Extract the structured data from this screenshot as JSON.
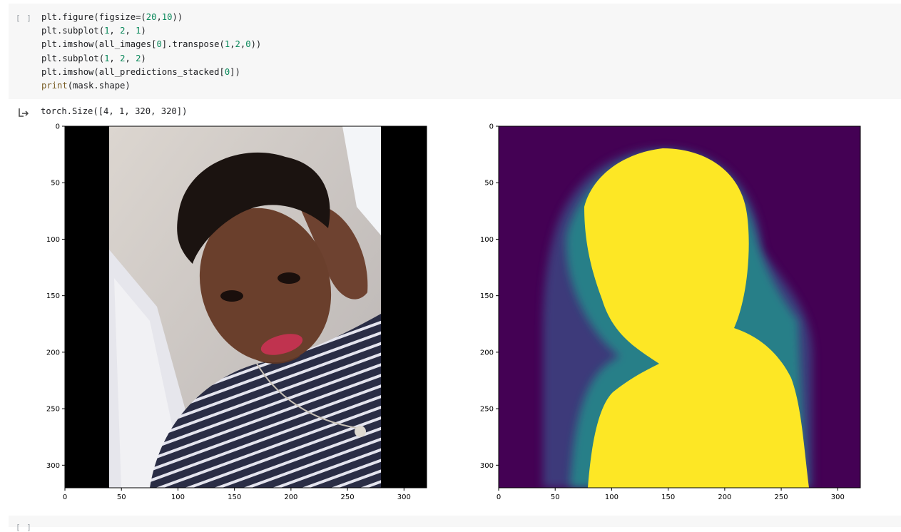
{
  "code_cell": {
    "run_label": "[ ]",
    "lines": [
      [
        {
          "t": "plt.figure(figsize=("
        },
        {
          "t": "20",
          "c": "num"
        },
        {
          "t": ","
        },
        {
          "t": "10",
          "c": "num"
        },
        {
          "t": "))"
        }
      ],
      [
        {
          "t": "plt.subplot("
        },
        {
          "t": "1",
          "c": "num"
        },
        {
          "t": ", "
        },
        {
          "t": "2",
          "c": "num"
        },
        {
          "t": ", "
        },
        {
          "t": "1",
          "c": "num"
        },
        {
          "t": ")"
        }
      ],
      [
        {
          "t": "plt.imshow(all_images["
        },
        {
          "t": "0",
          "c": "num"
        },
        {
          "t": "].transpose("
        },
        {
          "t": "1",
          "c": "num"
        },
        {
          "t": ","
        },
        {
          "t": "2",
          "c": "num"
        },
        {
          "t": ","
        },
        {
          "t": "0",
          "c": "num"
        },
        {
          "t": "))"
        }
      ],
      [
        {
          "t": "plt.subplot("
        },
        {
          "t": "1",
          "c": "num"
        },
        {
          "t": ", "
        },
        {
          "t": "2",
          "c": "num"
        },
        {
          "t": ", "
        },
        {
          "t": "2",
          "c": "num"
        },
        {
          "t": ")"
        }
      ],
      [
        {
          "t": "plt.imshow(all_predictions_stacked["
        },
        {
          "t": "0",
          "c": "num"
        },
        {
          "t": "])"
        }
      ],
      [
        {
          "t": "print",
          "c": "kw"
        },
        {
          "t": "(mask.shape)"
        }
      ]
    ]
  },
  "output": {
    "text": "torch.Size([4, 1, 320, 320])"
  },
  "bottom_cell": {
    "run_label": "[ ]"
  },
  "plots": {
    "x_ticks": [
      0,
      50,
      100,
      150,
      200,
      250,
      300
    ],
    "y_ticks": [
      0,
      50,
      100,
      150,
      200,
      250,
      300
    ],
    "extent": 320,
    "left_image": "photo-of-woman",
    "right_image": "segmentation-mask",
    "colors": {
      "mask_background": "#440154",
      "mask_foreground": "#fde725",
      "mask_edge": "#21918c"
    }
  }
}
